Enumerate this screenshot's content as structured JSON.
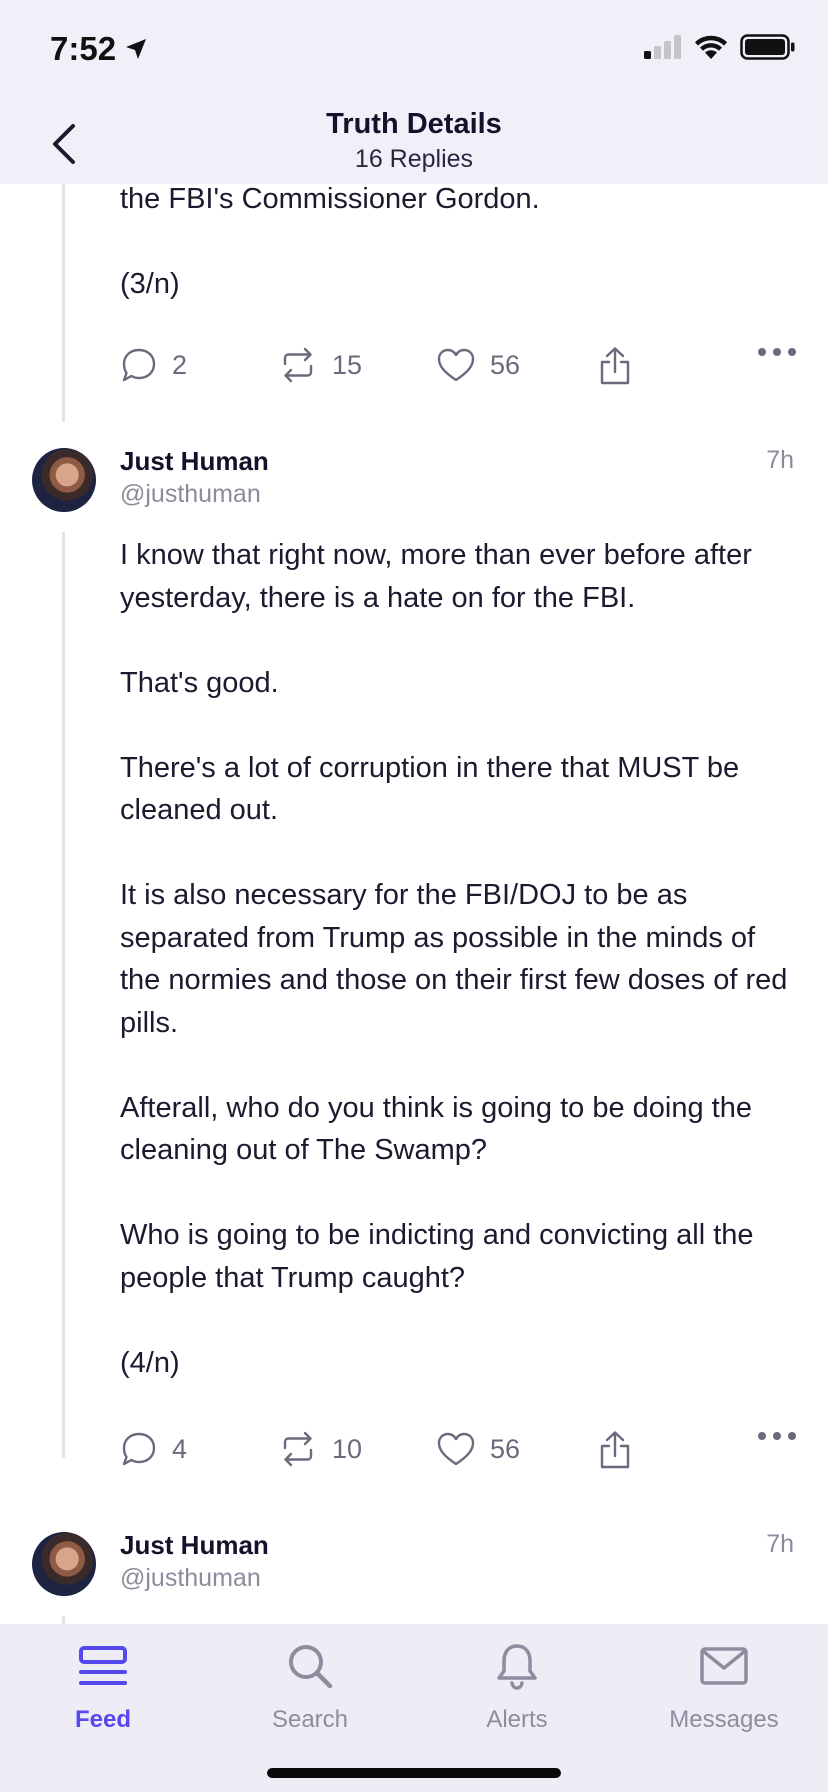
{
  "status": {
    "time": "7:52"
  },
  "header": {
    "title": "Truth Details",
    "subtitle": "16 Replies"
  },
  "post1": {
    "paragraphs": [
      "the FBI's Commissioner Gordon.",
      "(3/n)"
    ],
    "actions": {
      "replies": "2",
      "retruths": "15",
      "likes": "56"
    }
  },
  "post2": {
    "author": {
      "name": "Just Human",
      "handle": "@justhuman"
    },
    "time": "7h",
    "paragraphs": [
      "I know that right now, more than ever before after yesterday, there is a hate on for the FBI.",
      "That's good.",
      "There's a lot of corruption in there that MUST be cleaned out.",
      "It is also necessary for the FBI/DOJ to be as separated from Trump as possible in the minds of the normies and those on their first few doses of red pills.",
      "Afterall, who do you think is going to be doing the cleaning out of The Swamp?",
      "Who is going to be indicting and convicting all the people that Trump caught?",
      "(4/n)"
    ],
    "actions": {
      "replies": "4",
      "retruths": "10",
      "likes": "56"
    }
  },
  "post3": {
    "author": {
      "name": "Just Human",
      "handle": "@justhuman"
    },
    "time": "7h"
  },
  "tabs": {
    "feed": "Feed",
    "search": "Search",
    "alerts": "Alerts",
    "messages": "Messages"
  },
  "colors": {
    "accent": "#5448ee",
    "muted": "#8e8c9e",
    "bar_bg": "#eeedf6"
  }
}
